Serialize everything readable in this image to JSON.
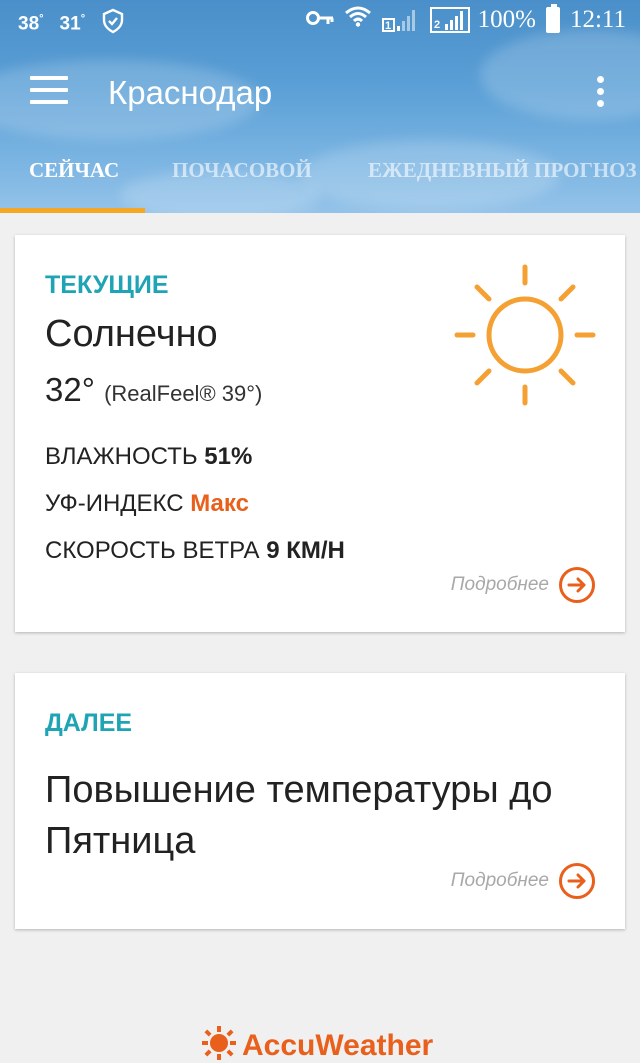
{
  "status_bar": {
    "temp1": "38",
    "temp1_unit": "°",
    "temp2": "31",
    "temp2_unit": "°",
    "battery": "100%",
    "time": "12:11",
    "icons": [
      "shield-icon",
      "key-icon",
      "wifi-icon",
      "signal-icon",
      "signal-icon",
      "battery-icon"
    ]
  },
  "app_bar": {
    "title": "Краснодар",
    "menu_icon": "hamburger-icon",
    "more_icon": "more-vert-icon"
  },
  "tabs": [
    {
      "label": "СЕЙЧАС",
      "active": true
    },
    {
      "label": "ПОЧАСОВОЙ",
      "active": false
    },
    {
      "label": "ЕЖЕДНЕВНЫЙ ПРОГНОЗ",
      "active": false
    }
  ],
  "current": {
    "label": "ТЕКУЩИЕ",
    "condition": "Солнечно",
    "temperature": "32°",
    "realfeel": "(RealFeel® 39°)",
    "weather_icon": "sun-icon",
    "humidity_label": "ВЛАЖНОСТЬ",
    "humidity_value": "51%",
    "uv_label": "УФ-ИНДЕКС",
    "uv_value": "Макс",
    "wind_label": "СКОРОСТЬ ВЕТРА",
    "wind_value": "9 КМ/Н",
    "more_label": "Подробнее"
  },
  "next": {
    "label": "ДАЛЕЕ",
    "text": "Повышение температуры до Пятница",
    "more_label": "Подробнее"
  },
  "footer": {
    "brand": "AccuWeather"
  },
  "colors": {
    "accent_teal": "#1fa4b6",
    "accent_orange": "#e8601c",
    "sun": "#f5a033",
    "tab_indicator": "#f5a623"
  }
}
